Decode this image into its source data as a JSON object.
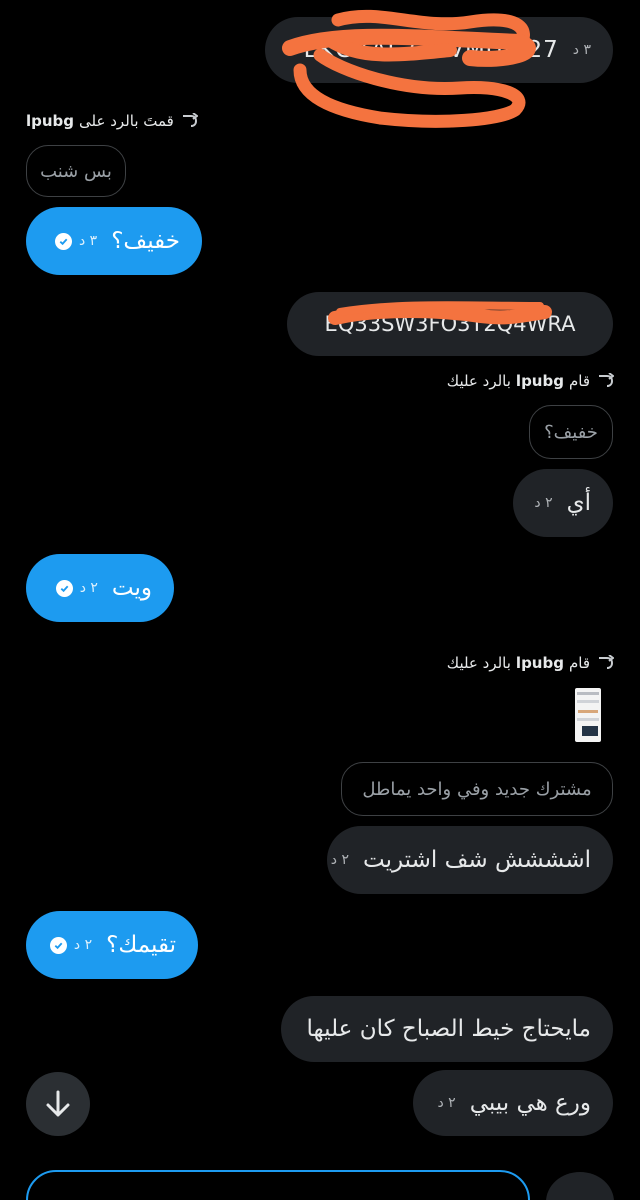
{
  "conversation": {
    "messages": [
      {
        "text": "EKGXAL23SVMUJK27",
        "time": "٣ د"
      },
      {
        "reply": {
          "prefix": "قمتَ بالرد على",
          "user": "lpubg",
          "suffix": ""
        },
        "quote": "بس شنب"
      },
      {
        "text": "خفيف؟",
        "time": "٣ د"
      },
      {
        "text": "EQ33SW3FO3T2Q4WRA"
      },
      {
        "reply": {
          "prefix": "قام",
          "user": "lpubg",
          "suffix": "بالرد عليك"
        },
        "quote": "خفيف؟"
      },
      {
        "text": "أي",
        "time": "٢ د"
      },
      {
        "text": "ويت",
        "time": "٢ د"
      },
      {
        "reply": {
          "prefix": "قام",
          "user": "lpubg",
          "suffix": "بالرد عليك"
        },
        "quote": "مشترك جديد وفي واحد يماطل"
      },
      {
        "text": "اشششش شف اشتريت",
        "time": "٢ د"
      },
      {
        "text": "تقيمك؟",
        "time": "٢ د"
      },
      {
        "text": "مايحتاج خيط الصباح كان عليها"
      },
      {
        "text": "ورع هي بيبي",
        "time": "٢ د"
      }
    ]
  },
  "icons": {
    "reply": "reply-arrow-icon",
    "read_receipt": "check-circle-icon",
    "scroll_down": "arrow-down-icon"
  },
  "colors": {
    "sent_bubble": "#1d9bf0",
    "received_bubble": "#202327",
    "background": "#000000",
    "redaction_scribble": "#f4733f"
  }
}
